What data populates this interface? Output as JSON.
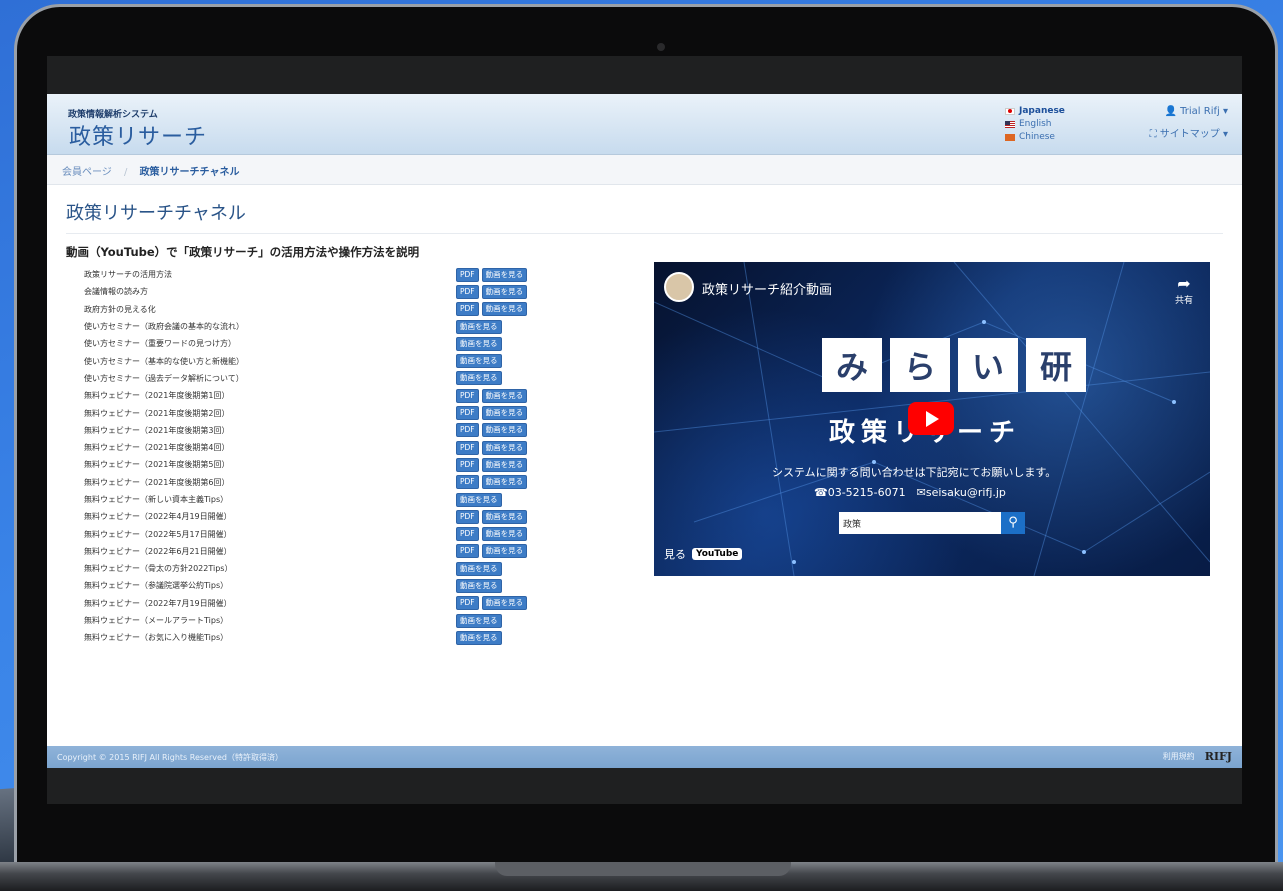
{
  "header": {
    "system_label": "政策情報解析システム",
    "logo": "政策リサーチ",
    "languages": [
      {
        "label": "Japanese",
        "flag": "jp-flag-icon",
        "active": true
      },
      {
        "label": "English",
        "flag": "us-flag-icon",
        "active": false
      },
      {
        "label": "Chinese",
        "flag": "cn-flag-icon",
        "active": false
      }
    ],
    "user_menu": "Trial Rifj",
    "sitemap_menu": "サイトマップ"
  },
  "breadcrumb": {
    "items": [
      "会員ページ",
      "政策リサーチチャネル"
    ],
    "separator": "/"
  },
  "main": {
    "page_title": "政策リサーチチャネル",
    "subtitle": "動画（YouTube）で「政策リサーチ」の活用方法や操作方法を説明",
    "buttons": {
      "pdf": "PDF",
      "video": "動画を見る"
    },
    "items": [
      {
        "title": "政策リサーチの活用方法",
        "pdf": true
      },
      {
        "title": "会議情報の読み方",
        "pdf": true
      },
      {
        "title": "政府方針の見える化",
        "pdf": true
      },
      {
        "title": "使い方セミナー（政府会議の基本的な流れ）",
        "pdf": false
      },
      {
        "title": "使い方セミナー（重要ワードの見つけ方）",
        "pdf": false
      },
      {
        "title": "使い方セミナー（基本的な使い方と新機能）",
        "pdf": false
      },
      {
        "title": "使い方セミナー（過去データ解析について）",
        "pdf": false
      },
      {
        "title": "無料ウェビナー（2021年度後期第1回）",
        "pdf": true
      },
      {
        "title": "無料ウェビナー（2021年度後期第2回）",
        "pdf": true
      },
      {
        "title": "無料ウェビナー（2021年度後期第3回）",
        "pdf": true
      },
      {
        "title": "無料ウェビナー（2021年度後期第4回）",
        "pdf": true
      },
      {
        "title": "無料ウェビナー（2021年度後期第5回）",
        "pdf": true
      },
      {
        "title": "無料ウェビナー（2021年度後期第6回）",
        "pdf": true
      },
      {
        "title": "無料ウェビナー（新しい資本主義Tips）",
        "pdf": false
      },
      {
        "title": "無料ウェビナー（2022年4月19日開催）",
        "pdf": true
      },
      {
        "title": "無料ウェビナー（2022年5月17日開催）",
        "pdf": true
      },
      {
        "title": "無料ウェビナー（2022年6月21日開催）",
        "pdf": true
      },
      {
        "title": "無料ウェビナー（骨太の方針2022Tips）",
        "pdf": false
      },
      {
        "title": "無料ウェビナー（参議院選挙公約Tips）",
        "pdf": false
      },
      {
        "title": "無料ウェビナー（2022年7月19日開催）",
        "pdf": true
      },
      {
        "title": "無料ウェビナー（メールアラートTips）",
        "pdf": false
      },
      {
        "title": "無料ウェビナー（お気に入り機能Tips）",
        "pdf": false
      }
    ]
  },
  "video": {
    "title": "政策リサーチ紹介動画",
    "share_label": "共有",
    "banner_chars": [
      "み",
      "ら",
      "い",
      "研"
    ],
    "headline": "政策リサーチ",
    "contact_line": "システムに関する問い合わせは下記宛にてお願いします。",
    "contact_detail": "☎03-5215-6071　✉seisaku@rifj.jp",
    "search_value": "政策",
    "watch_label": "見る",
    "youtube_label": "YouTube"
  },
  "footer": {
    "copyright": "Copyright © 2015 RIFJ All Rights Reserved（特許取得済）",
    "terms": "利用規約",
    "brand": "RIFJ"
  }
}
